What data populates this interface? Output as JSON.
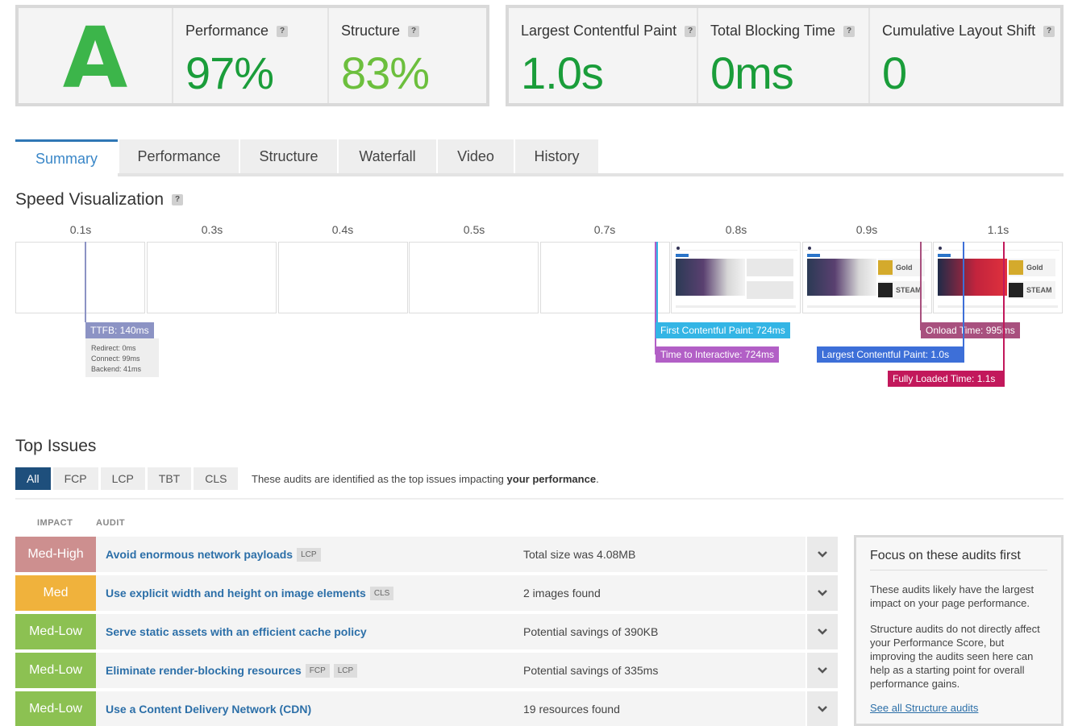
{
  "scores": {
    "grade": "A",
    "performance": {
      "label": "Performance",
      "value": "97%"
    },
    "structure": {
      "label": "Structure",
      "value": "83%"
    },
    "help": "?"
  },
  "vitals": {
    "lcp": {
      "label": "Largest Contentful Paint",
      "value": "1.0s"
    },
    "tbt": {
      "label": "Total Blocking Time",
      "value": "0ms"
    },
    "cls": {
      "label": "Cumulative Layout Shift",
      "value": "0"
    }
  },
  "tabs": [
    "Summary",
    "Performance",
    "Structure",
    "Waterfall",
    "Video",
    "History"
  ],
  "speed": {
    "title": "Speed Visualization",
    "ticks": [
      "0.1s",
      "0.3s",
      "0.4s",
      "0.5s",
      "0.7s",
      "0.8s",
      "0.9s",
      "1.1s"
    ],
    "ttfb": {
      "label": "TTFB: 140ms",
      "redirect": "Redirect: 0ms",
      "connect": "Connect: 99ms",
      "backend": "Backend: 41ms"
    },
    "markers": {
      "fcp": "First Contentful Paint: 724ms",
      "tti": "Time to Interactive: 724ms",
      "lcp": "Largest Contentful Paint: 1.0s",
      "onload": "Onload Time: 995ms",
      "fully": "Fully Loaded Time: 1.1s"
    },
    "thumb_text": {
      "gold": "Gold",
      "steam": "STEAM"
    }
  },
  "issues": {
    "title": "Top Issues",
    "filters": [
      "All",
      "FCP",
      "LCP",
      "TBT",
      "CLS"
    ],
    "note_pre": "These audits are identified as the top issues impacting",
    "note_bold": "your performance",
    "note_post": ".",
    "col_impact": "IMPACT",
    "col_audit": "AUDIT",
    "rows": [
      {
        "impact": "Med-High",
        "audit": "Avoid enormous network payloads",
        "tags": [
          "LCP"
        ],
        "detail": "Total size was 4.08MB"
      },
      {
        "impact": "Med",
        "audit": "Use explicit width and height on image elements",
        "tags": [
          "CLS"
        ],
        "detail": "2 images found"
      },
      {
        "impact": "Med-Low",
        "audit": "Serve static assets with an efficient cache policy",
        "tags": [],
        "detail": "Potential savings of 390KB"
      },
      {
        "impact": "Med-Low",
        "audit": "Eliminate render-blocking resources",
        "tags": [
          "FCP",
          "LCP"
        ],
        "detail": "Potential savings of 335ms"
      },
      {
        "impact": "Med-Low",
        "audit": "Use a Content Delivery Network (CDN)",
        "tags": [],
        "detail": "19 resources found"
      }
    ]
  },
  "focus": {
    "title": "Focus on these audits first",
    "p1": "These audits likely have the largest impact on your page performance.",
    "p2": "Structure audits do not directly affect your Performance Score, but improving the audits seen here can help as a starting point for overall performance gains.",
    "link": "See all Structure audits"
  },
  "colors": {
    "med_high": "#cd8f8f",
    "med": "#f0b23c",
    "med_low": "#8cc152",
    "accent": "#2f77b5",
    "fcp": "#33b5e5",
    "tti": "#b25fc6",
    "lcp": "#3d6fd8",
    "onload": "#a8507e",
    "fully": "#c2185b",
    "ttfb": "#8c93c4"
  }
}
